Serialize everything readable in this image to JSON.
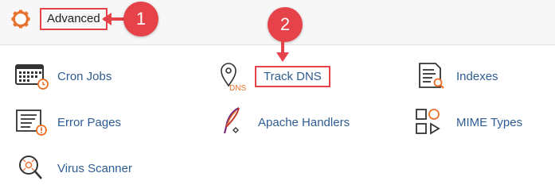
{
  "header": {
    "title": "Advanced",
    "icon": "gear-icon",
    "accent": "#e5424a"
  },
  "callouts": [
    {
      "number": "1"
    },
    {
      "number": "2"
    }
  ],
  "items": [
    {
      "label": "Cron Jobs",
      "icon": "cron-calendar-icon"
    },
    {
      "label": "Track DNS",
      "icon": "dns-pin-icon",
      "icon_text": "DNS"
    },
    {
      "label": "Indexes",
      "icon": "document-search-icon"
    },
    {
      "label": "Error Pages",
      "icon": "error-page-icon"
    },
    {
      "label": "Apache Handlers",
      "icon": "feather-icon"
    },
    {
      "label": "MIME Types",
      "icon": "mime-shapes-icon"
    },
    {
      "label": "Virus Scanner",
      "icon": "virus-scan-icon"
    }
  ],
  "colors": {
    "link": "#2d5c93",
    "icon_orange": "#e8702a",
    "header_bg": "#f7f7f7"
  }
}
